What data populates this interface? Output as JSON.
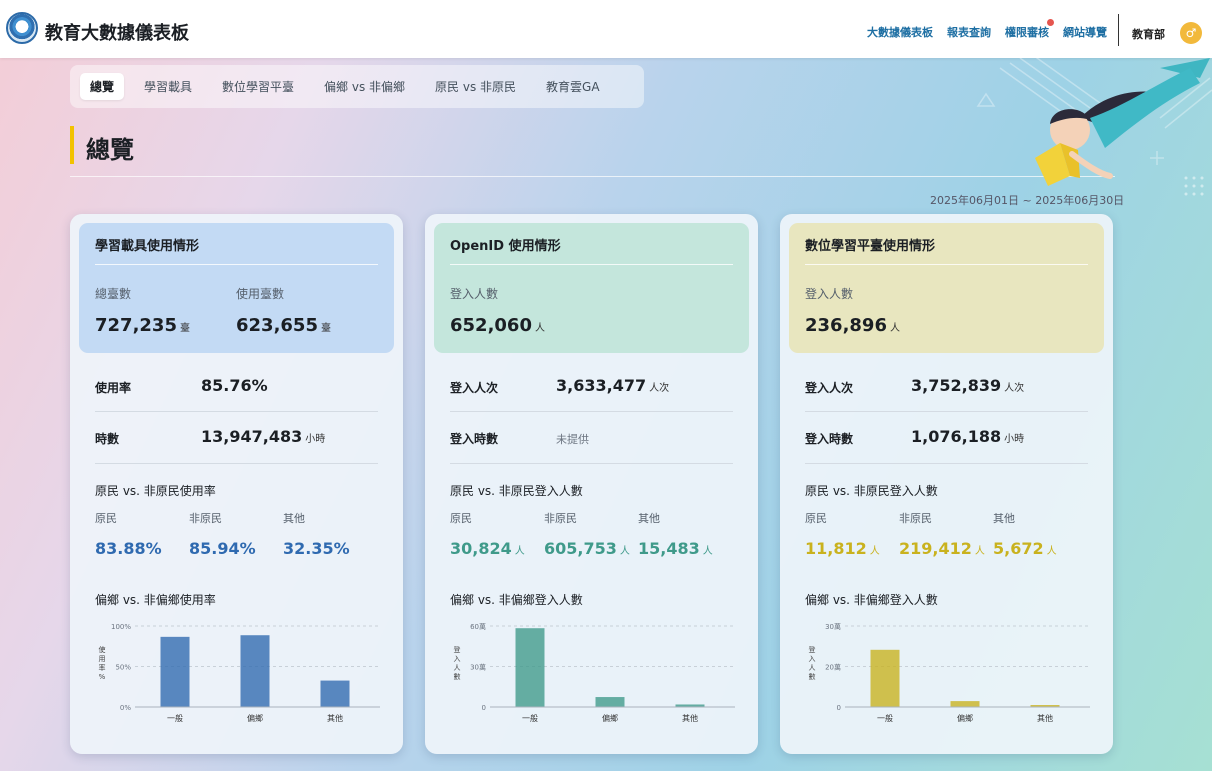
{
  "header": {
    "title": "教育大數據儀表板",
    "nav": [
      "大數據儀表板",
      "報表查詢",
      "權限審核",
      "網站導覽"
    ],
    "org": "教育部",
    "avatar_glyph": "♂"
  },
  "tabs": [
    "總覽",
    "學習載具",
    "數位學習平臺",
    "偏鄉 vs 非偏鄉",
    "原民 vs 非原民",
    "教育雲GA"
  ],
  "section_title": "總覽",
  "date_range": "2025年06月01日 ~ 2025年06月30日",
  "colors": {
    "device": "#2f6ab0",
    "openid": "#3f9a8a",
    "platform": "#c9b21e"
  },
  "cards": [
    {
      "title": "學習載具使用情形",
      "top_bg": "#c3daf4",
      "metrics": [
        {
          "label": "總臺數",
          "value": "727,235",
          "unit": "臺"
        },
        {
          "label": "使用臺數",
          "value": "623,655",
          "unit": "臺"
        }
      ],
      "rows": [
        {
          "label": "使用率",
          "value": "85.76%",
          "unit": ""
        },
        {
          "label": "時數",
          "value": "13,947,483",
          "unit": "小時"
        }
      ],
      "indig_title": "原民 vs. 非原民使用率",
      "indig": [
        {
          "label": "原民",
          "value": "83.88%",
          "unit": ""
        },
        {
          "label": "非原民",
          "value": "85.94%",
          "unit": ""
        },
        {
          "label": "其他",
          "value": "32.35%",
          "unit": ""
        }
      ],
      "rural_title": "偏鄉 vs. 非偏鄉使用率",
      "chart_data": {
        "type": "bar",
        "categories": [
          "一般",
          "偏鄉",
          "其他"
        ],
        "values": [
          86,
          88,
          32
        ],
        "ylim": [
          0,
          100
        ],
        "yticks": [
          "0%",
          "50%",
          "100%"
        ],
        "ylabel": "使用率%"
      }
    },
    {
      "title": "OpenID 使用情形",
      "top_bg": "#c4e6dc",
      "metrics": [
        {
          "label": "登入人數",
          "value": "652,060",
          "unit": "人"
        }
      ],
      "rows": [
        {
          "label": "登入人次",
          "value": "3,633,477",
          "unit": "人次"
        },
        {
          "label": "登入時數",
          "value": "未提供",
          "unit": ""
        }
      ],
      "indig_title": "原民 vs. 非原民登入人數",
      "indig": [
        {
          "label": "原民",
          "value": "30,824",
          "unit": "人"
        },
        {
          "label": "非原民",
          "value": "605,753",
          "unit": "人"
        },
        {
          "label": "其他",
          "value": "15,483",
          "unit": "人"
        }
      ],
      "rural_title": "偏鄉 vs. 非偏鄉登入人數",
      "chart_data": {
        "type": "bar",
        "categories": [
          "一般",
          "偏鄉",
          "其他"
        ],
        "values": [
          58,
          7,
          1.5
        ],
        "ylim": [
          0,
          60
        ],
        "yticks": [
          "0",
          "30萬",
          "60萬"
        ],
        "ylabel": "登入人數"
      }
    },
    {
      "title": "數位學習平臺使用情形",
      "top_bg": "#e8e6bf",
      "metrics": [
        {
          "label": "登入人數",
          "value": "236,896",
          "unit": "人"
        }
      ],
      "rows": [
        {
          "label": "登入人次",
          "value": "3,752,839",
          "unit": "人次"
        },
        {
          "label": "登入時數",
          "value": "1,076,188",
          "unit": "小時"
        }
      ],
      "indig_title": "原民 vs. 非原民登入人數",
      "indig": [
        {
          "label": "原民",
          "value": "11,812",
          "unit": "人"
        },
        {
          "label": "非原民",
          "value": "219,412",
          "unit": "人"
        },
        {
          "label": "其他",
          "value": "5,672",
          "unit": "人"
        }
      ],
      "rural_title": "偏鄉 vs. 非偏鄉登入人數",
      "chart_data": {
        "type": "bar",
        "categories": [
          "一般",
          "偏鄉",
          "其他"
        ],
        "values": [
          21,
          2,
          0.5
        ],
        "ylim": [
          0,
          30
        ],
        "yticks": [
          "0",
          "20萬",
          "30萬"
        ],
        "ylabel": "登入人數"
      }
    }
  ]
}
